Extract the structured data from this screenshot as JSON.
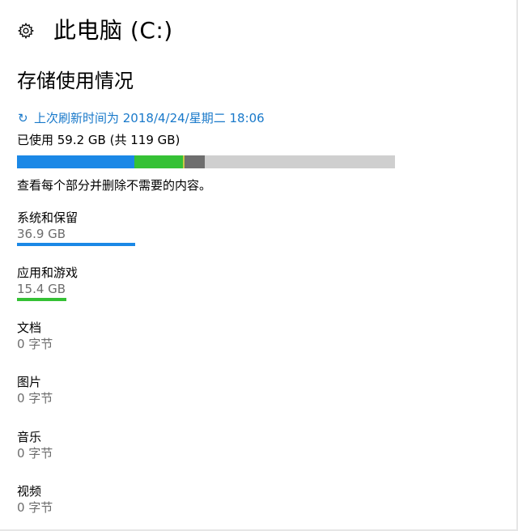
{
  "header": {
    "title": "此电脑 (C:)",
    "icon": "gear-icon"
  },
  "section": {
    "title": "存储使用情况"
  },
  "refresh": {
    "icon": "refresh-icon",
    "glyph": "↻",
    "text": "上次刷新时间为 2018/4/24/星期二 18:06",
    "color": "#1979ca"
  },
  "usage": {
    "text": "已使用 59.2 GB (共 119 GB)",
    "used_gb": 59.2,
    "total_gb": 119,
    "segments": [
      {
        "name": "system",
        "gb": 36.9,
        "color": "#1b88e6"
      },
      {
        "name": "apps",
        "gb": 15.4,
        "color": "#35c135"
      },
      {
        "name": "divider",
        "gb": 0.4,
        "color": "#c7c94a"
      },
      {
        "name": "other",
        "gb": 6.5,
        "color": "#6e6e6e"
      }
    ],
    "track_color": "#cfcfcf"
  },
  "hint": "查看每个部分并删除不需要的内容。",
  "categories": [
    {
      "name": "系统和保留",
      "size": "36.9 GB",
      "fraction": 0.2,
      "color": "#1b88e6"
    },
    {
      "name": "应用和游戏",
      "size": "15.4 GB",
      "fraction": 0.083,
      "color": "#35c135"
    },
    {
      "name": "文档",
      "size": "0 字节",
      "fraction": 0,
      "color": "#1b88e6"
    },
    {
      "name": "图片",
      "size": "0 字节",
      "fraction": 0,
      "color": "#1b88e6"
    },
    {
      "name": "音乐",
      "size": "0 字节",
      "fraction": 0,
      "color": "#1b88e6"
    },
    {
      "name": "视频",
      "size": "0 字节",
      "fraction": 0,
      "color": "#1b88e6"
    }
  ]
}
